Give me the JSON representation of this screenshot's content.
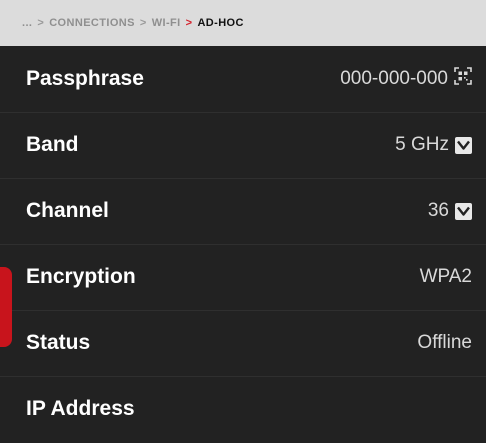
{
  "breadcrumb": {
    "ellipsis": "...",
    "sep": ">",
    "level1": "CONNECTIONS",
    "level2": "WI-FI",
    "current": "AD-HOC"
  },
  "settings": {
    "passphrase": {
      "label": "Passphrase",
      "value": "000-000-000",
      "icon": "qr-code-icon"
    },
    "band": {
      "label": "Band",
      "value": "5 GHz",
      "icon": "chevron-down-icon"
    },
    "channel": {
      "label": "Channel",
      "value": "36",
      "icon": "chevron-down-icon"
    },
    "encryption": {
      "label": "Encryption",
      "value": "WPA2"
    },
    "status": {
      "label": "Status",
      "value": "Offline"
    },
    "ip_address": {
      "label": "IP Address",
      "value": ""
    }
  },
  "colors": {
    "background": "#222222",
    "breadcrumb_background": "#dcdcdc",
    "accent": "#c8141c",
    "label_text": "#ffffff",
    "value_text": "#d9d9d9"
  }
}
